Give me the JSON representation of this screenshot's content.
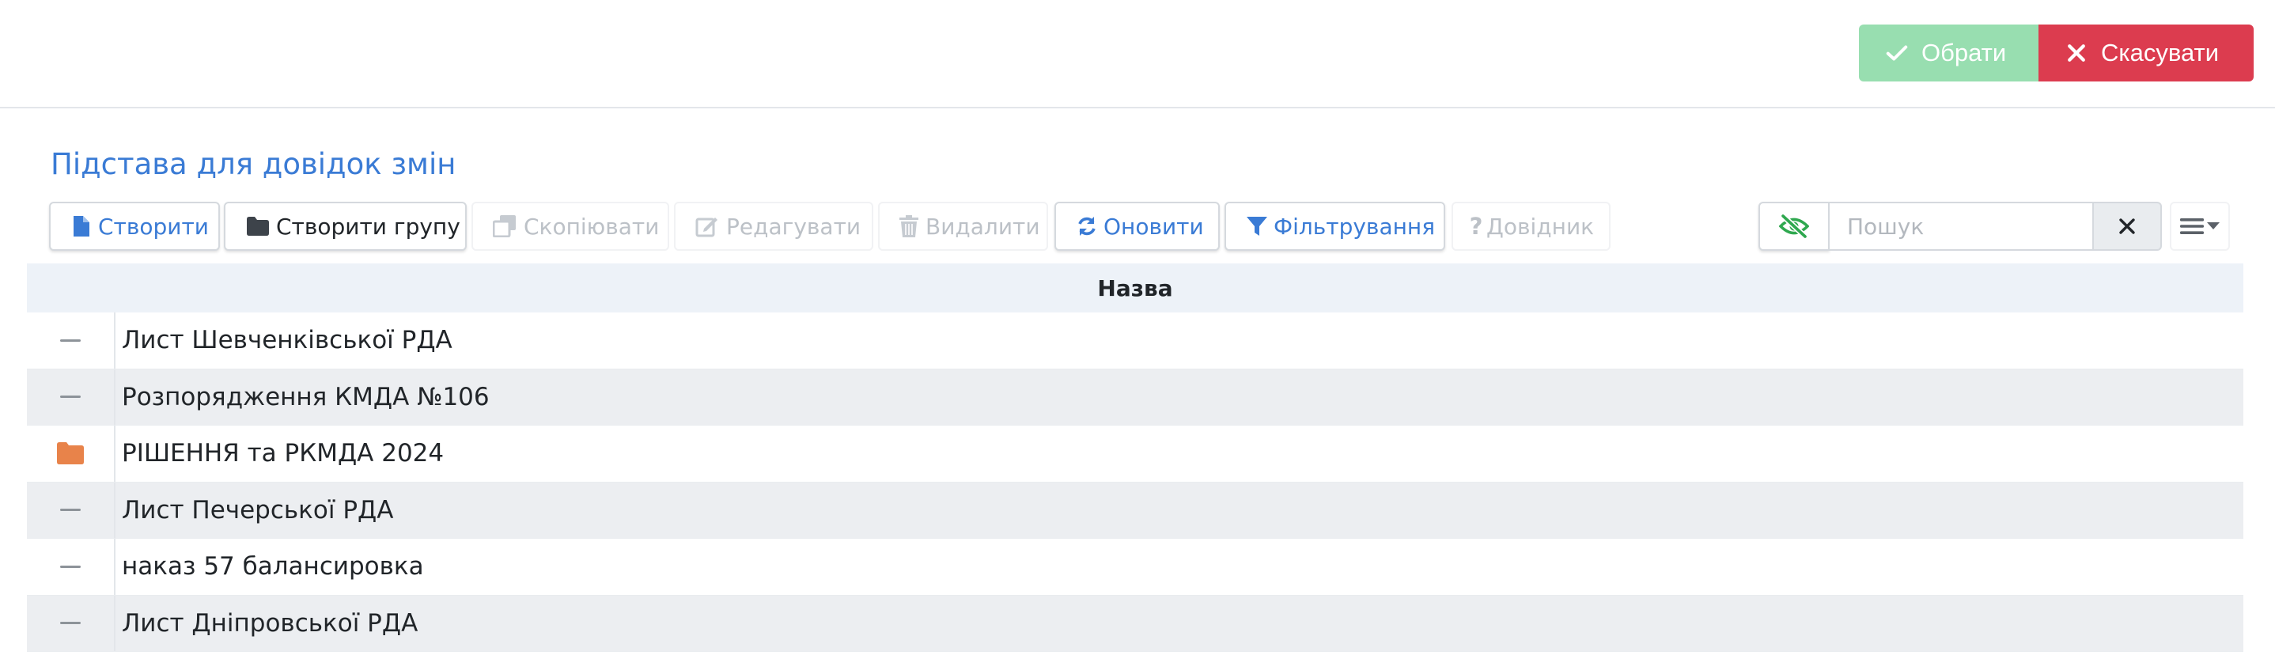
{
  "header": {
    "select_label": "Обрати",
    "cancel_label": "Скасувати"
  },
  "page": {
    "title": "Підстава для довідок змін"
  },
  "toolbar": {
    "create_label": "Створити",
    "create_group_label": "Створити групу",
    "copy_label": "Скопіювати",
    "edit_label": "Редагувати",
    "delete_label": "Видалити",
    "refresh_label": "Оновити",
    "filter_label": "Фільтрування",
    "help_label": "Довідник"
  },
  "search": {
    "placeholder": "Пошук",
    "value": ""
  },
  "table": {
    "columns": [
      "Назва"
    ],
    "rows": [
      {
        "type": "item",
        "name": "Лист Шевченківської РДА"
      },
      {
        "type": "item",
        "name": "Розпорядження КМДА №106"
      },
      {
        "type": "folder",
        "name": "РІШЕННЯ та РКМДА 2024"
      },
      {
        "type": "item",
        "name": "Лист Печерської РДА"
      },
      {
        "type": "item",
        "name": "наказ 57 балансировка"
      },
      {
        "type": "item",
        "name": "Лист Дніпровської РДА"
      }
    ]
  },
  "colors": {
    "select_button": "#98deb0",
    "cancel_button": "#dc3c4f",
    "accent_blue": "#3a7bd5",
    "folder": "#e8834a",
    "header_row": "#edf2f8"
  },
  "icons": {
    "select": "check-icon",
    "cancel": "close-icon",
    "create": "file-icon",
    "create_group": "folder-icon",
    "copy": "copy-icon",
    "edit": "edit-icon",
    "delete": "trash-icon",
    "refresh": "refresh-icon",
    "filter": "filter-icon",
    "help": "question-icon",
    "visibility": "eye-slash-icon",
    "clear": "close-icon",
    "columns": "menu-icon",
    "item": "dash-icon",
    "folder": "folder-icon"
  }
}
